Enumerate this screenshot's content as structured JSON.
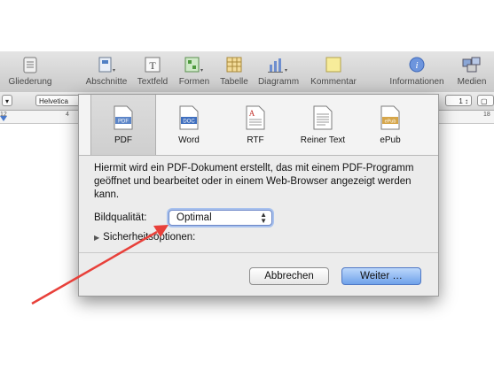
{
  "toolbar": {
    "items": [
      {
        "label": "Gliederung",
        "icon": "outline-icon"
      },
      {
        "label": "Abschnitte",
        "icon": "sections-icon"
      },
      {
        "label": "Textfeld",
        "icon": "textbox-icon"
      },
      {
        "label": "Formen",
        "icon": "shapes-icon"
      },
      {
        "label": "Tabelle",
        "icon": "table-icon"
      },
      {
        "label": "Diagramm",
        "icon": "chart-icon"
      },
      {
        "label": "Kommentar",
        "icon": "comment-icon"
      },
      {
        "label": "Informationen",
        "icon": "info-icon"
      },
      {
        "label": "Medien",
        "icon": "media-icon"
      }
    ]
  },
  "formatbar": {
    "font": "Helvetica",
    "stepper_value": "1"
  },
  "ruler": {
    "marks": [
      "12",
      "4",
      "18"
    ]
  },
  "export_sheet": {
    "tabs": [
      {
        "label": "PDF",
        "badge": "PDF",
        "selected": true
      },
      {
        "label": "Word",
        "badge": "DOC",
        "selected": false
      },
      {
        "label": "RTF",
        "badge": "A",
        "selected": false
      },
      {
        "label": "Reiner Text",
        "badge": "",
        "selected": false
      },
      {
        "label": "ePub",
        "badge": "ePub",
        "selected": false
      }
    ],
    "description": "Hiermit wird ein PDF-Dokument erstellt, das mit einem PDF-Programm geöffnet und bearbeitet oder in einem Web-Browser angezeigt werden kann.",
    "quality_label": "Bildqualität:",
    "quality_value": "Optimal",
    "security_label": "Sicherheitsoptionen:",
    "cancel_label": "Abbrechen",
    "next_label": "Weiter …"
  },
  "colors": {
    "accent": "#6fa1ea",
    "annotation_arrow": "#e8403a"
  }
}
